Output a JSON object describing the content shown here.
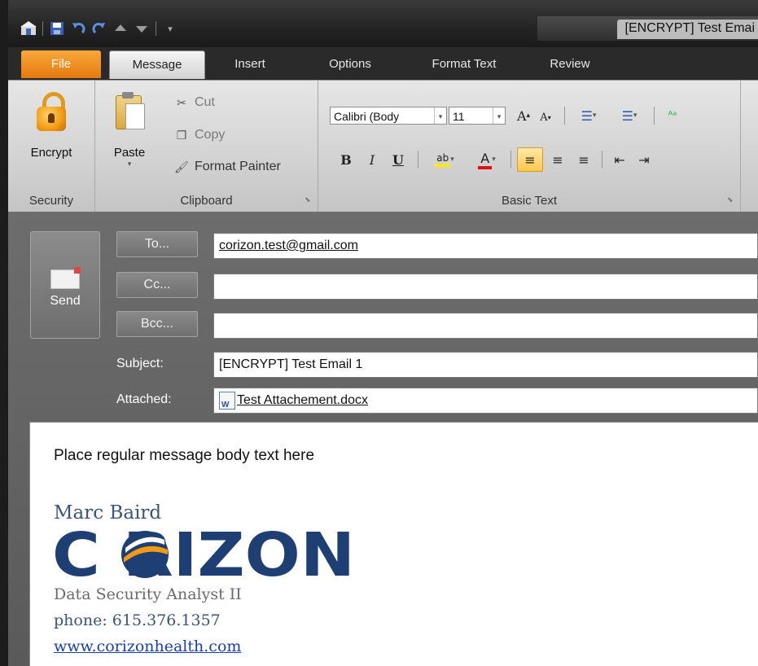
{
  "window": {
    "title": "[ENCRYPT] Test Emai"
  },
  "tabs": [
    {
      "label": "File"
    },
    {
      "label": "Message"
    },
    {
      "label": "Insert"
    },
    {
      "label": "Options"
    },
    {
      "label": "Format Text"
    },
    {
      "label": "Review"
    }
  ],
  "ribbon": {
    "security": {
      "encrypt_label": "Encrypt",
      "group_label": "Security"
    },
    "clipboard": {
      "paste_label": "Paste",
      "cut_label": "Cut",
      "copy_label": "Copy",
      "format_painter_label": "Format Painter",
      "group_label": "Clipboard"
    },
    "basic_text": {
      "font_name": "Calibri (Body",
      "font_size": "11",
      "group_label": "Basic Text"
    }
  },
  "compose": {
    "send_label": "Send",
    "to_button": "To...",
    "cc_button": "Cc...",
    "bcc_button": "Bcc...",
    "subject_label": "Subject:",
    "attached_label": "Attached:",
    "to_value": "corizon.test@gmail.com",
    "cc_value": "",
    "bcc_value": "",
    "subject_value": "[ENCRYPT] Test Email 1",
    "attachment_name": "Test Attachement.docx"
  },
  "body": {
    "text": "Place regular message body text here",
    "signature": {
      "name": "Marc Baird",
      "logo_text": "CORIZON",
      "title": "Data Security Analyst II",
      "phone_label": "phone:",
      "phone": "615.376.1357",
      "website": "www.corizonhealth.com"
    }
  },
  "colors": {
    "file_tab": "#e57a10",
    "logo_navy": "#1d3f73",
    "logo_orange": "#f29a12",
    "link": "#1a3cb4"
  }
}
